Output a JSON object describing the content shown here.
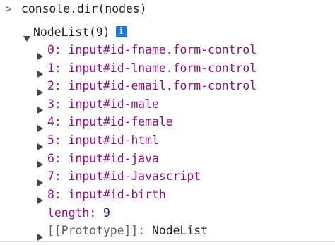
{
  "command": {
    "prompt": ">",
    "text": "console.dir(nodes)"
  },
  "nodelist": {
    "label": "NodeList(9)",
    "info_badge": "i",
    "items": [
      {
        "index": "0:",
        "tag": "input",
        "id": "#id-fname",
        "cls": ".form-control"
      },
      {
        "index": "1:",
        "tag": "input",
        "id": "#id-lname",
        "cls": ".form-control"
      },
      {
        "index": "2:",
        "tag": "input",
        "id": "#id-email",
        "cls": ".form-control"
      },
      {
        "index": "3:",
        "tag": "input",
        "id": "#id-male",
        "cls": ""
      },
      {
        "index": "4:",
        "tag": "input",
        "id": "#id-female",
        "cls": ""
      },
      {
        "index": "5:",
        "tag": "input",
        "id": "#id-html",
        "cls": ""
      },
      {
        "index": "6:",
        "tag": "input",
        "id": "#id-java",
        "cls": ""
      },
      {
        "index": "7:",
        "tag": "input",
        "id": "#id-Javascript",
        "cls": ""
      },
      {
        "index": "8:",
        "tag": "input",
        "id": "#id-birth",
        "cls": ""
      }
    ],
    "length_key": "length:",
    "length_value": "9",
    "prototype_key": "[[Prototype]]:",
    "prototype_value": "NodeList"
  },
  "colors": {
    "index_purple": "#881280",
    "number_blue": "#1a1aa6",
    "badge_blue": "#1a73e8",
    "text": "#1f1f1f"
  },
  "icons": {
    "prompt": "chevron-right-icon",
    "expanded": "triangle-down-icon",
    "collapsed": "triangle-right-icon",
    "info": "info-icon"
  }
}
